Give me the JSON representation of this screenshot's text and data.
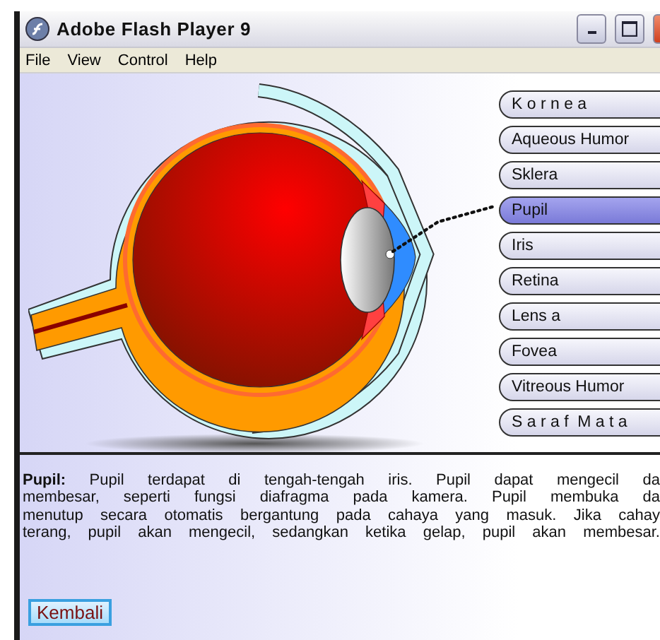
{
  "window": {
    "title": "Adobe Flash Player 9"
  },
  "menu": [
    "File",
    "View",
    "Control",
    "Help"
  ],
  "parts": [
    {
      "label": "K o r n e a",
      "selected": false
    },
    {
      "label": "Aqueous Humor",
      "selected": false
    },
    {
      "label": "Sklera",
      "selected": false
    },
    {
      "label": "Pupil",
      "selected": true
    },
    {
      "label": "Iris",
      "selected": false
    },
    {
      "label": "Retina",
      "selected": false
    },
    {
      "label": "Lens a",
      "selected": false
    },
    {
      "label": "Fovea",
      "selected": false
    },
    {
      "label": "Vitreous Humor",
      "selected": false
    },
    {
      "label": "S a r a f  M a t a",
      "selected": false
    }
  ],
  "description": "**Pupil:**  Pupil terdapat di tengah-tengah iris. Pupil dapat mengecil da\nmembesar, seperti fungsi diafragma pada kamera. Pupil membuka da\nmenutup secara otomatis bergantung pada cahaya yang masuk. Jika cahay\nterang, pupil akan mengecil, sedangkan ketika gelap, pupil akan membesar.",
  "back_button": "Kembali"
}
